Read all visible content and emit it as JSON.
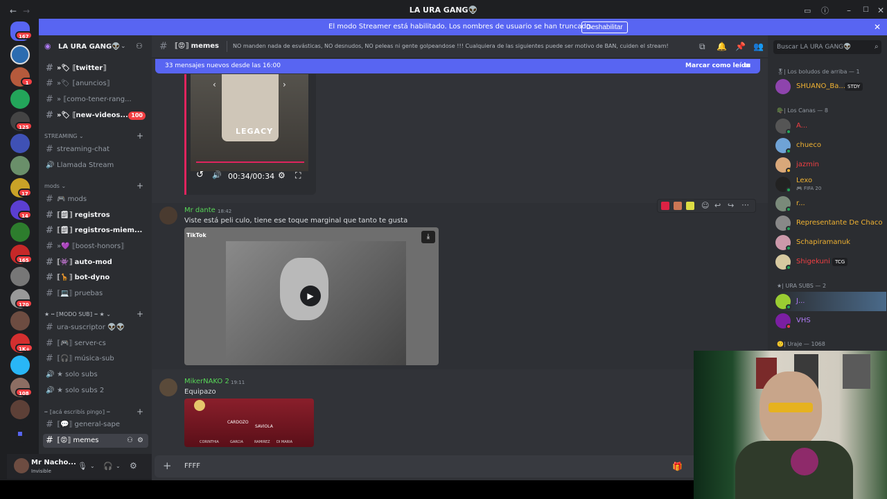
{
  "window": {
    "title": "LA URA GANG👽"
  },
  "banner": {
    "text": "El modo Streamer está habilitado. Los nombres de usuario se han truncado.",
    "button": "Deshabilitar"
  },
  "servers": {
    "dm_badge": "167",
    "badges": [
      "1",
      "125",
      "17",
      "14",
      "165",
      "170",
      "1K+",
      "108"
    ]
  },
  "guild": {
    "name": "LA URA GANG👽"
  },
  "channels": [
    {
      "label": "»🏷 ⟦twitter⟧",
      "unread": true
    },
    {
      "label": "»🏷 ⟦anuncios⟧",
      "unread": false
    },
    {
      "label": "» ⟦como-tener-rang...",
      "unread": false
    },
    {
      "label": "»🏷 ⟦new-videos...",
      "unread": true,
      "badge": "100"
    }
  ],
  "streaming": {
    "category": "STREAMING",
    "chat": "streaming-chat",
    "voice": "Llamada Stream"
  },
  "mods": {
    "category": "mods",
    "items": [
      "🎮 mods",
      "⟦🗒⟧ registros",
      "⟦🗒⟧ registros-miem...",
      "»💜 ⟦boost-honors⟧",
      "⟦👾⟧ auto-mod",
      "⟦🦒⟧ bot-dyno",
      "⟦💻⟧ pruebas"
    ]
  },
  "modosub": {
    "category": "★ ┅ ⟦MODO SUB⟧ ┅ ★",
    "items": [
      "ura-suscriptor 👽👽",
      "⟦🎮⟧ server-cs",
      "⟦🎧⟧ música-sub",
      "★ solo subs",
      "★ solo subs 2"
    ]
  },
  "pingo": {
    "category": "┅ ⟦acá escribís pingo⟧ ┅",
    "items": [
      "⟦💬⟧ general-sape",
      "⟦😡⟧ memes"
    ]
  },
  "user": {
    "name": "Mr Nacho...",
    "status": "Invisible"
  },
  "chat": {
    "channel": "⟦😡⟧ memes",
    "topic": "NO manden nada de esvásticas, NO desnudos, NO peleas ni gente golpeandose !!! Cualquiera de las siguientes puede ser motivo de BAN, cuiden el stream!",
    "new_messages": "33 mensajes nuevos desde las 16:00",
    "mark_read": "Marcar como leído",
    "video1": {
      "time": "00:34/00:34",
      "brand": "LEGACY"
    },
    "messages": [
      {
        "author": "Mr dante",
        "time": "18:42",
        "text": "Viste está peli culo, tiene ese toque marginal que tanto te gusta",
        "embed": "TikTok"
      },
      {
        "author": "MikerNAKO 2",
        "time": "19:11",
        "text": "Equipazo",
        "image_labels": [
          "CARDOZO",
          "SAVIOLA",
          "CORINTHIA",
          "GARCIA",
          "RAMIREZ",
          "DI MARIA"
        ]
      }
    ],
    "composer_value": "FFFF"
  },
  "members": {
    "search_placeholder": "Buscar LA URA GANG👽",
    "groups": [
      {
        "title": "🎖| Los boludos de arriba — 1",
        "members": [
          {
            "name": "SHUANO_Ba...",
            "color": "#f0b232",
            "tag": "STDY"
          }
        ]
      },
      {
        "title": "🪖| Los Canas — 8",
        "members": [
          {
            "name": "A...",
            "color": "#f23f43"
          },
          {
            "name": "chueco",
            "color": "#f0b232"
          },
          {
            "name": "jazmin",
            "color": "#f23f43"
          },
          {
            "name": "Lexo",
            "color": "#f0b232",
            "sub": "🎮 FIFA 20"
          },
          {
            "name": "r...",
            "color": "#f0b232"
          },
          {
            "name": "Representante De Chaco",
            "color": "#f0b232"
          },
          {
            "name": "Schapiramanuk",
            "color": "#f0b232"
          },
          {
            "name": "Shigekuni",
            "color": "#f23f43",
            "tag": "TCG"
          }
        ]
      },
      {
        "title": "★| URA SUBS — 2",
        "members": [
          {
            "name": "J...",
            "color": "#b07bf6"
          },
          {
            "name": "VHS",
            "color": "#b07bf6"
          }
        ]
      },
      {
        "title": "🙂| Uraje — 1068",
        "members": []
      }
    ]
  }
}
